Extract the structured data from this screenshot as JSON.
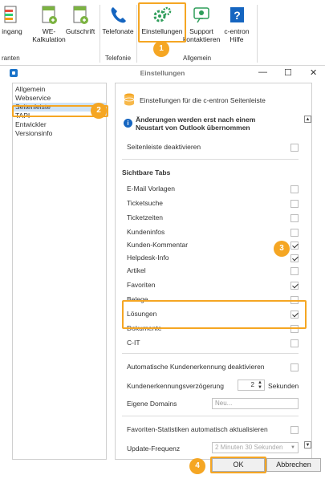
{
  "ribbon": {
    "buttons": {
      "eingang": "ingang",
      "we_kalkulation_1": "WE-",
      "we_kalkulation_2": "Kalkulation",
      "gutschrift": "Gutschrift",
      "telefonate": "Telefonate",
      "einstellungen": "Einstellungen",
      "support_1": "Support",
      "support_2": "kontaktieren",
      "hilfe_1": "c-entron",
      "hilfe_2": "Hilfe"
    },
    "groups": {
      "varianten": "ranten",
      "telefonie": "Telefonie",
      "allgemein": "Allgemein"
    },
    "badge": "1"
  },
  "dialog": {
    "title": "Einstellungen",
    "window_controls": {
      "minimize": "—",
      "maximize": "☐",
      "close": "✕"
    },
    "nav": {
      "items": [
        "Allgemein",
        "Webservice",
        "Seitenleiste",
        "TAPI",
        "Entwickler",
        "Versionsinfo"
      ],
      "selected": "Seitenleiste",
      "badge": "2"
    },
    "content": {
      "header": "Einstellungen für die c-entron Seitenleiste",
      "notice": "Änderungen werden erst nach einem Neustart von Outlook übernommen",
      "deactivate_label": "Seitenleiste deaktivieren",
      "tabs_heading": "Sichtbare Tabs",
      "tabs": [
        {
          "label": "E-Mail Vorlagen",
          "checked": false
        },
        {
          "label": "Ticketsuche",
          "checked": false
        },
        {
          "label": "Ticketzeiten",
          "checked": false
        },
        {
          "label": "Kundeninfos",
          "checked": false
        },
        {
          "label": "Kunden-Kommentar",
          "checked": true
        },
        {
          "label": "Helpdesk-Info",
          "checked": true
        },
        {
          "label": "Artikel",
          "checked": false
        },
        {
          "label": "Favoriten",
          "checked": true
        },
        {
          "label": "Belege",
          "checked": false
        },
        {
          "label": "Lösungen",
          "checked": true
        },
        {
          "label": "Dokumente",
          "checked": false
        },
        {
          "label": "C-IT",
          "checked": false
        }
      ],
      "badge": "3",
      "auto_recognition_label": "Automatische Kundenerkennung deaktivieren",
      "delay_label": "Kundenerkennungsverzögerung",
      "delay_value": "2",
      "delay_unit": "Sekunden",
      "domains_label": "Eigene Domains",
      "domains_placeholder": "Neu...",
      "favorites_label": "Favoriten-Statistiken automatisch aktualisieren",
      "update_label": "Update-Frequenz",
      "update_value": "2 Minuten 30 Sekunden"
    },
    "buttons": {
      "ok": "OK",
      "cancel": "Abbrechen",
      "badge": "4"
    }
  },
  "colors": {
    "accent": "#f5a623",
    "selection": "#cfe3f7"
  }
}
